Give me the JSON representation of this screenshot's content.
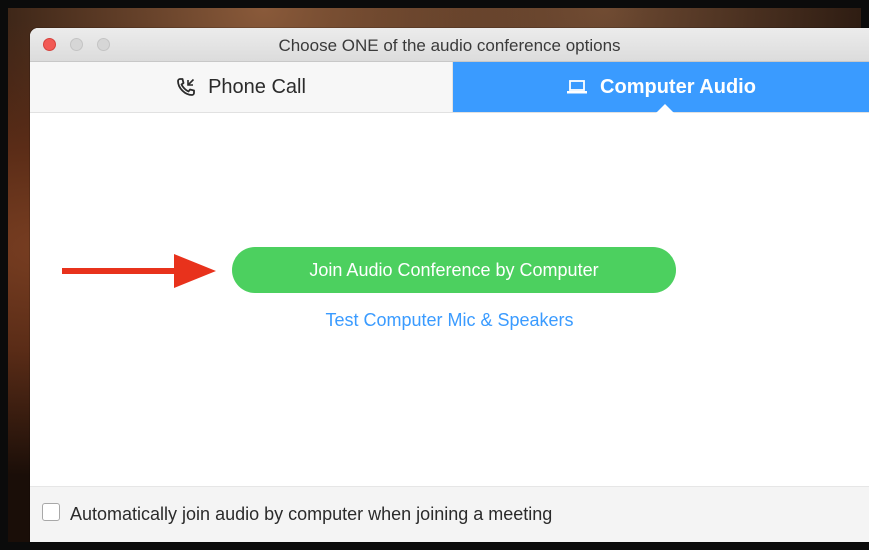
{
  "window": {
    "title": "Choose ONE of the audio conference options"
  },
  "tabs": [
    {
      "label": "Phone Call",
      "icon": "phone-icon",
      "selected": false
    },
    {
      "label": "Computer Audio",
      "icon": "laptop-icon",
      "selected": true
    }
  ],
  "main": {
    "join_button_label": "Join Audio Conference by Computer",
    "test_link_label": "Test Computer Mic & Speakers"
  },
  "footer": {
    "auto_join_label": "Automatically join audio by computer when joining a meeting",
    "auto_join_checked": false
  },
  "colors": {
    "accent_blue": "#3a9bff",
    "join_green": "#4cd05f",
    "arrow_red": "#e8321c",
    "close_red": "#f25a55"
  }
}
